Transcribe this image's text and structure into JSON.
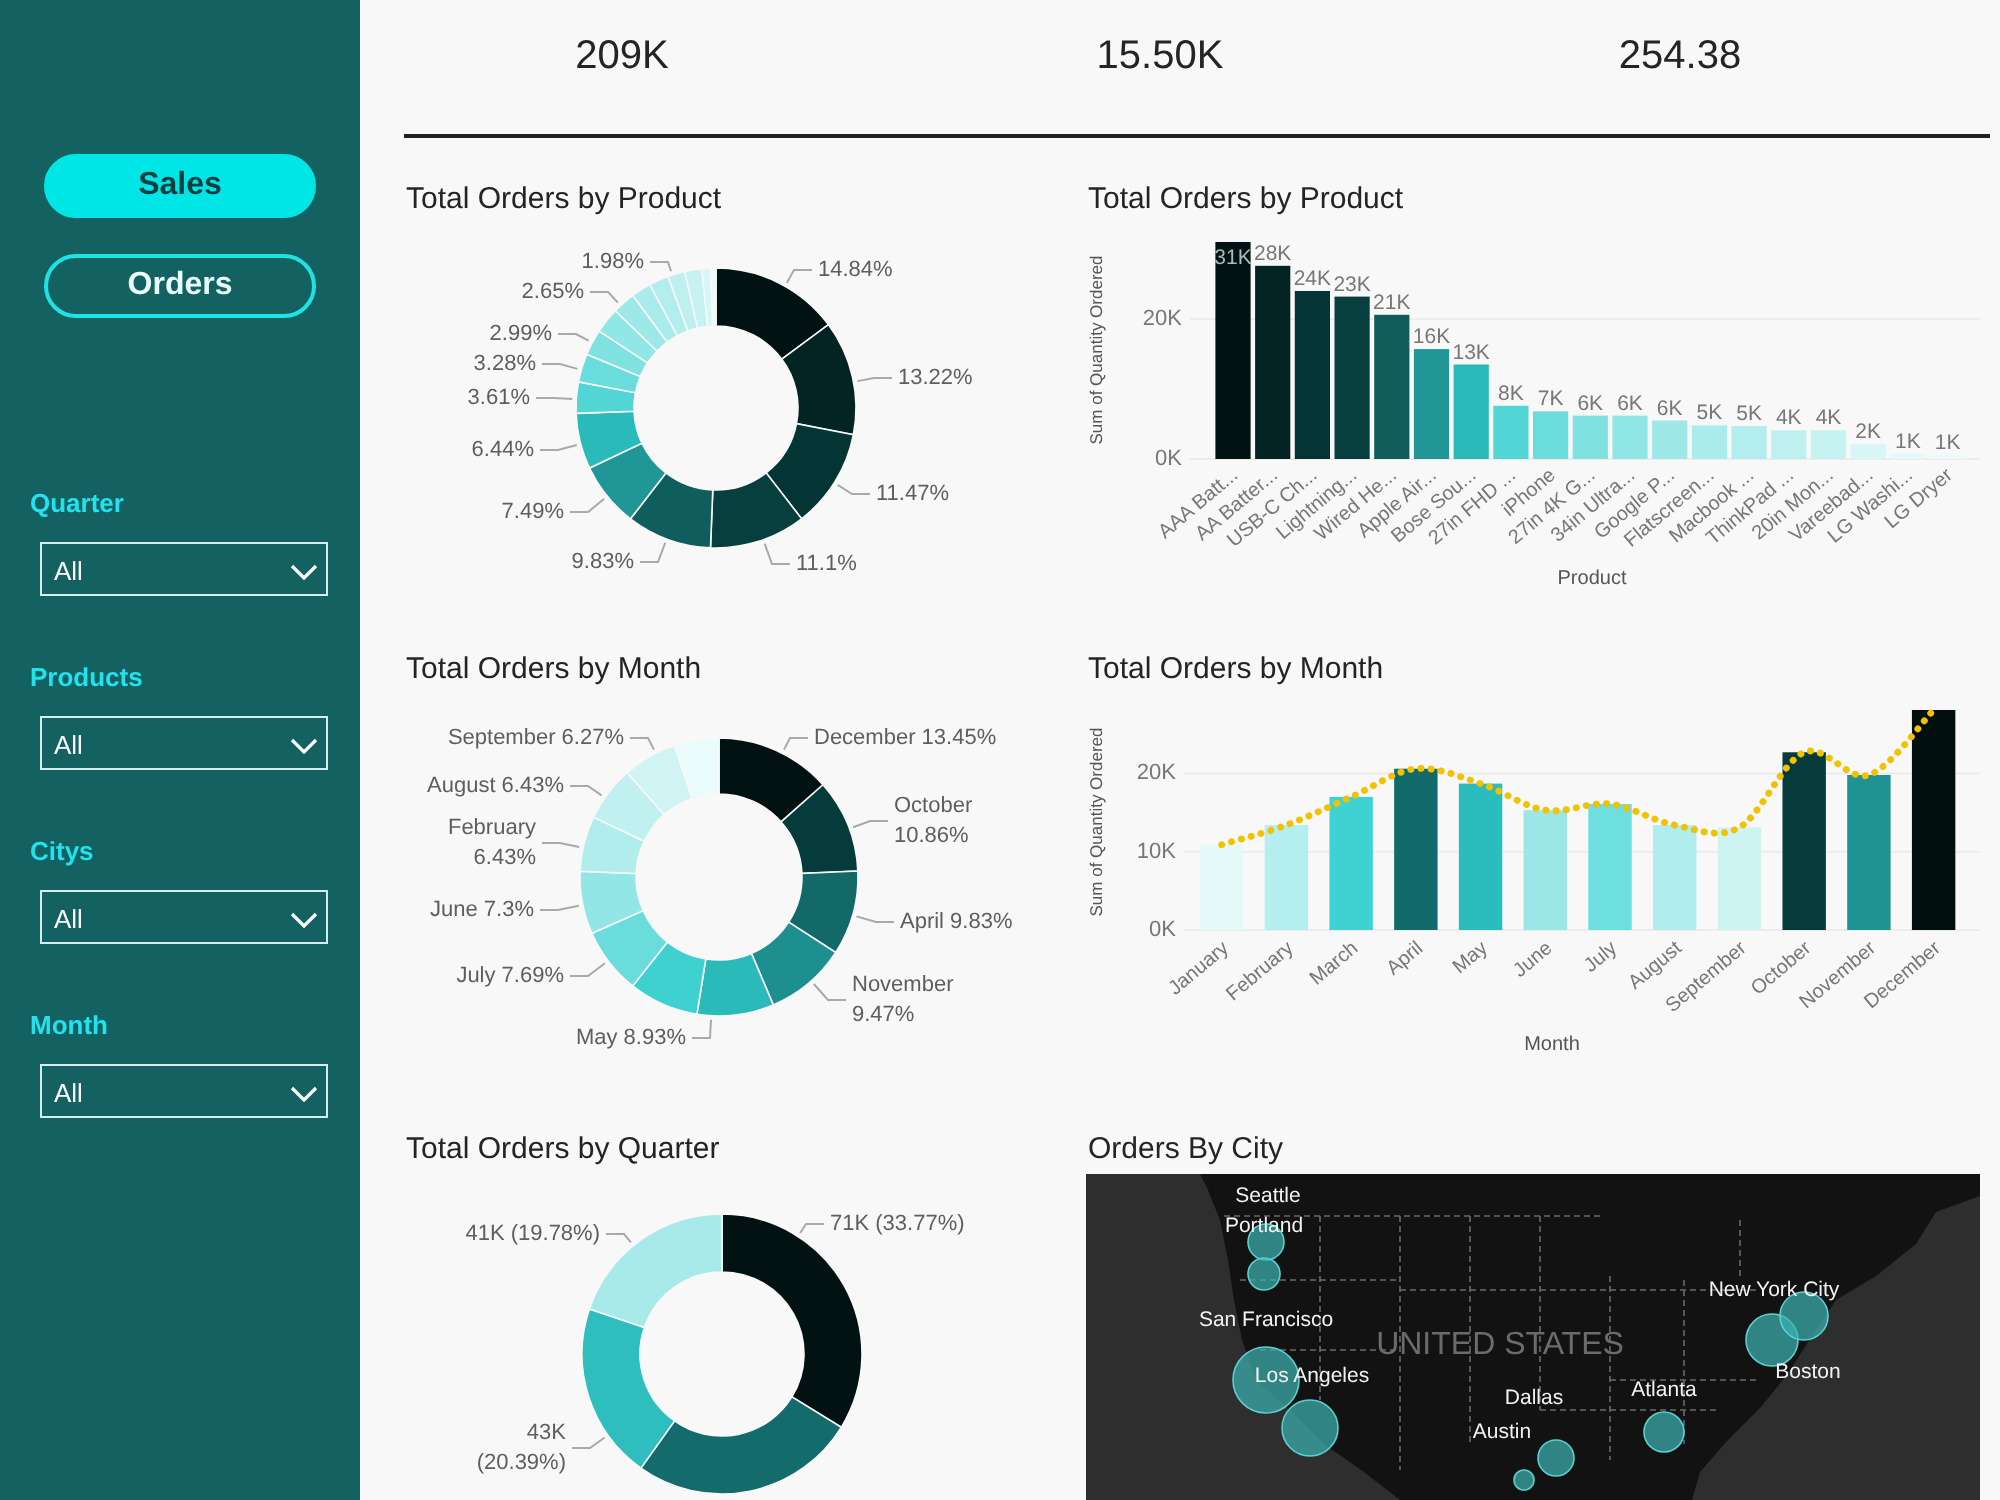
{
  "sidebar": {
    "nav_buttons": [
      {
        "label": "Sales",
        "selected": true
      },
      {
        "label": "Orders",
        "selected": false
      }
    ],
    "filters": [
      {
        "label": "Quarter",
        "value": "All"
      },
      {
        "label": "Products",
        "value": "All"
      },
      {
        "label": "Citys",
        "value": "All"
      },
      {
        "label": "Month",
        "value": "All"
      }
    ]
  },
  "kpis": [
    {
      "value": "209K"
    },
    {
      "value": "15.50K"
    },
    {
      "value": "254.38"
    }
  ],
  "panels": [
    {
      "kind": "chart",
      "chart_data": {
        "type": "donut",
        "title": "Total Orders by Product",
        "values": [
          14.84,
          13.22,
          11.47,
          11.1,
          9.83,
          7.49,
          6.44,
          3.61,
          3.28,
          2.99,
          2.96,
          2.65,
          2.3,
          2.26,
          1.98,
          1.97,
          0.99,
          0.32,
          0.31
        ],
        "value_labels": [
          "14.84%",
          "13.22%",
          "11.47%",
          "11.1%",
          "9.83%",
          "7.49%",
          "6.44%",
          "3.61%",
          "3.28%",
          "2.99%",
          null,
          "2.65%",
          null,
          null,
          "1.98%",
          null,
          null,
          null,
          null
        ]
      }
    },
    {
      "kind": "chart",
      "chart_data": {
        "type": "bar",
        "title": "Total Orders by Product",
        "xlabel": "Product",
        "ylabel": "Sum of Quantity Ordered",
        "categories": [
          "AAA Batt...",
          "AA Batter...",
          "USB-C Ch...",
          "Lightning...",
          "Wired He...",
          "Apple Air...",
          "Bose Sou...",
          "27in FHD ...",
          "iPhone",
          "27in 4K G...",
          "34in Ultra...",
          "Google P...",
          "Flatscreen...",
          "Macbook ...",
          "ThinkPad ...",
          "20in Mon...",
          "Vareebad...",
          "LG Washi...",
          "LG Dryer"
        ],
        "values": [
          31000,
          27600,
          24000,
          23200,
          20600,
          15700,
          13500,
          7600,
          6800,
          6200,
          6200,
          5500,
          4800,
          4700,
          4100,
          4100,
          2100,
          700,
          600
        ],
        "ylim": [
          0,
          31000
        ],
        "yticks": [
          {
            "value": 0,
            "label": "0K"
          },
          {
            "value": 20000,
            "label": "20K"
          }
        ],
        "value_labels": [
          "31K",
          "28K",
          "24K",
          "23K",
          "21K",
          "16K",
          "13K",
          "8K",
          "7K",
          "6K",
          "6K",
          "6K",
          "5K",
          "5K",
          "4K",
          "4K",
          "2K",
          "1K",
          "1K"
        ]
      }
    },
    {
      "kind": "chart",
      "chart_data": {
        "type": "donut",
        "title": "Total Orders by Month",
        "categories": [
          "December",
          "October",
          "April",
          "November",
          "May",
          null,
          "July",
          "June",
          "February",
          "August",
          "September",
          null
        ],
        "values": [
          13.45,
          10.86,
          9.83,
          9.47,
          8.93,
          8.13,
          7.69,
          7.3,
          6.43,
          6.43,
          6.27,
          5.21
        ],
        "value_labels": [
          "13.45%",
          "10.86%",
          "9.83%",
          "9.47%",
          "8.93%",
          null,
          "7.69%",
          "7.3%",
          "6.43%",
          "6.43%",
          "6.27%",
          null
        ]
      }
    },
    {
      "kind": "chart",
      "chart_data": {
        "type": "bar",
        "title": "Total Orders by Month",
        "xlabel": "Month",
        "ylabel": "Sum of Quantity Ordered",
        "categories": [
          "January",
          "February",
          "March",
          "April",
          "May",
          "June",
          "July",
          "August",
          "September",
          "October",
          "November",
          "December"
        ],
        "series": [
          {
            "type": "bar",
            "colors": [
              "#e6f9f9",
              "#b5eeee",
              "#3fd2d2",
              "#136a6a",
              "#2bbdbd",
              "#9be7e7",
              "#6ddfdf",
              "#b0eded",
              "#cdf3f3",
              "#073b3b",
              "#1f9393",
              "#020f0f"
            ],
            "values": [
              10900,
              13400,
              17000,
              20600,
              18700,
              15300,
              16100,
              13400,
              13100,
              22700,
              19800,
              28100
            ]
          },
          {
            "type": "line",
            "color": "#f2c200",
            "line_style": "dotted",
            "values": [
              10900,
              13400,
              17000,
              20600,
              18700,
              15300,
              16100,
              13400,
              13100,
              22700,
              19800,
              28100
            ]
          }
        ],
        "ylim": [
          0,
          28100
        ],
        "yticks": [
          {
            "value": 0,
            "label": "0K"
          },
          {
            "value": 10000,
            "label": "10K"
          },
          {
            "value": 20000,
            "label": "20K"
          }
        ]
      }
    },
    {
      "kind": "chart",
      "chart_data": {
        "type": "donut",
        "title": "Total Orders by Quarter",
        "values": [
          33.77,
          26.06,
          20.39,
          19.78
        ],
        "value_labels": [
          "71K (33.77%)",
          null,
          "43K (20.39%)",
          "41K (19.78%)"
        ]
      }
    },
    {
      "kind": "map",
      "title": "Orders By City",
      "country_label": "UNITED STATES",
      "cities": [
        "Seattle",
        "Portland",
        "San Francisco",
        "Los Angeles",
        "New York City",
        "Boston",
        "Dallas",
        "Atlanta",
        "Austin"
      ]
    }
  ]
}
